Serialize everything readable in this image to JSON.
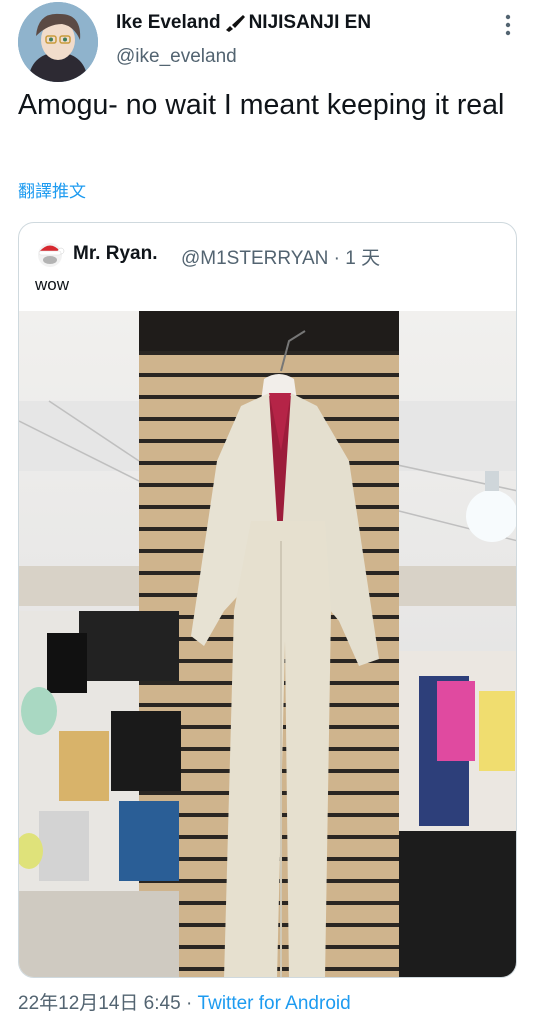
{
  "author": {
    "display_name": "Ike Eveland",
    "org": "NIJISANJI EN",
    "handle": "@ike_eveland"
  },
  "tweet": {
    "text": "Amogu- no wait I meant keeping it real",
    "translate_label": "翻譯推文"
  },
  "quoted": {
    "display_name": "Mr. Ryan.",
    "handle_time": "@M1STERRYAN · 1 天",
    "text": "wow"
  },
  "meta": {
    "date_time": "22年12月14日 6:45 · ",
    "source": "Twitter for Android"
  },
  "colors": {
    "link": "#1d9bf0",
    "secondary_text": "#536471",
    "border": "#cfd9de"
  },
  "icons": [
    "more-options-icon",
    "paintbrush-icon"
  ]
}
